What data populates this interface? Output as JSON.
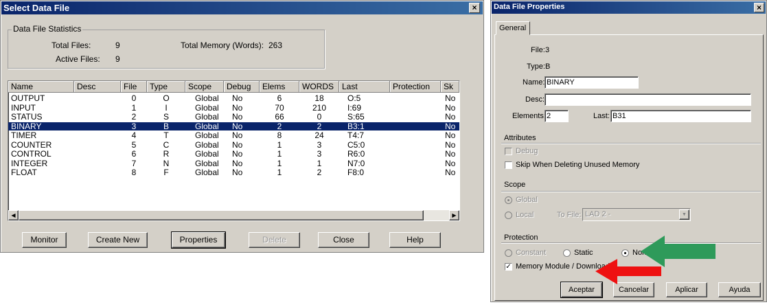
{
  "left_dialog": {
    "title": "Select Data File",
    "close_glyph": "×",
    "stats": {
      "group_title": "Data File Statistics",
      "total_files_label": "Total Files:",
      "total_files": "9",
      "active_files_label": "Active Files:",
      "active_files": "9",
      "total_memory_label": "Total Memory (Words):",
      "total_memory": "263"
    },
    "table": {
      "columns": [
        "Name",
        "Desc",
        "File",
        "Type",
        "Scope",
        "Debug",
        "Elems",
        "WORDS",
        "Last",
        "Protection",
        "Sk"
      ],
      "rows": [
        {
          "name": "OUTPUT",
          "desc": "",
          "file": "0",
          "type": "O",
          "scope": "Global",
          "debug": "No",
          "elems": "6",
          "words": "18",
          "last": "O:5",
          "sk": "No"
        },
        {
          "name": "INPUT",
          "desc": "",
          "file": "1",
          "type": "I",
          "scope": "Global",
          "debug": "No",
          "elems": "70",
          "words": "210",
          "last": "I:69",
          "sk": "No"
        },
        {
          "name": "STATUS",
          "desc": "",
          "file": "2",
          "type": "S",
          "scope": "Global",
          "debug": "No",
          "elems": "66",
          "words": "0",
          "last": "S:65",
          "sk": "No"
        },
        {
          "name": "BINARY",
          "desc": "",
          "file": "3",
          "type": "B",
          "scope": "Global",
          "debug": "No",
          "elems": "2",
          "words": "2",
          "last": "B3:1",
          "sk": "No"
        },
        {
          "name": "TIMER",
          "desc": "",
          "file": "4",
          "type": "T",
          "scope": "Global",
          "debug": "No",
          "elems": "8",
          "words": "24",
          "last": "T4:7",
          "sk": "No"
        },
        {
          "name": "COUNTER",
          "desc": "",
          "file": "5",
          "type": "C",
          "scope": "Global",
          "debug": "No",
          "elems": "1",
          "words": "3",
          "last": "C5:0",
          "sk": "No"
        },
        {
          "name": "CONTROL",
          "desc": "",
          "file": "6",
          "type": "R",
          "scope": "Global",
          "debug": "No",
          "elems": "1",
          "words": "3",
          "last": "R6:0",
          "sk": "No"
        },
        {
          "name": "INTEGER",
          "desc": "",
          "file": "7",
          "type": "N",
          "scope": "Global",
          "debug": "No",
          "elems": "1",
          "words": "1",
          "last": "N7:0",
          "sk": "No"
        },
        {
          "name": "FLOAT",
          "desc": "",
          "file": "8",
          "type": "F",
          "scope": "Global",
          "debug": "No",
          "elems": "1",
          "words": "2",
          "last": "F8:0",
          "sk": "No"
        }
      ],
      "selected_row": 3
    },
    "buttons": {
      "monitor": "Monitor",
      "create_new": "Create New",
      "properties": "Properties",
      "delete": "Delete",
      "close": "Close",
      "help": "Help"
    },
    "scroll_left_glyph": "◀",
    "scroll_right_glyph": "▶"
  },
  "right_dialog": {
    "title": "Data File Properties",
    "close_glyph": "×",
    "tab": "General",
    "file_label": "File:",
    "file_value": "3",
    "type_label": "Type:",
    "type_value": "B",
    "name_label": "Name:",
    "name_value": "BINARY",
    "desc_label": "Desc:",
    "desc_value": "",
    "elements_label": "Elements:",
    "elements_value": "2",
    "last_label": "Last:",
    "last_value": "B31",
    "attributes": {
      "title": "Attributes",
      "debug_label": "Debug",
      "debug_checked": false,
      "skip_label": "Skip When Deleting Unused Memory",
      "skip_checked": false
    },
    "scope": {
      "title": "Scope",
      "global_label": "Global",
      "local_label": "Local",
      "to_file_label": "To File:",
      "to_file_value": "LAD 2 -",
      "selected": "global"
    },
    "protection": {
      "title": "Protection",
      "constant_label": "Constant",
      "static_label": "Static",
      "none_label": "None",
      "selected": "none",
      "memory_module_label": "Memory Module / Download",
      "memory_module_checked": true
    },
    "buttons": {
      "accept": "Aceptar",
      "cancel": "Cancelar",
      "apply": "Aplicar",
      "help": "Ayuda"
    },
    "check_glyph": "✓",
    "dropdown_glyph": "▼"
  },
  "annotations": {
    "green_arrow_color": "#2e9a5a",
    "red_arrow_color": "#ee1111"
  }
}
